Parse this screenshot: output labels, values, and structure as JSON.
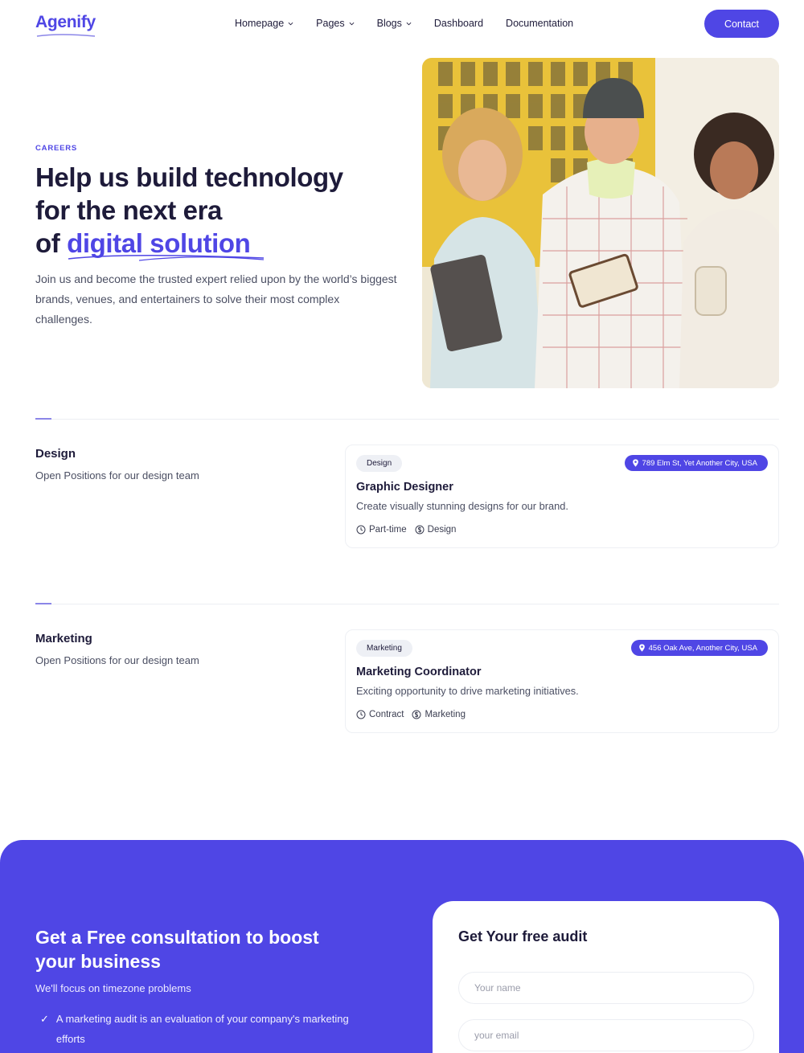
{
  "header": {
    "logo": "Agenify",
    "nav": [
      {
        "label": "Homepage",
        "has_dropdown": true
      },
      {
        "label": "Pages",
        "has_dropdown": true
      },
      {
        "label": "Blogs",
        "has_dropdown": true
      },
      {
        "label": "Dashboard",
        "has_dropdown": false
      },
      {
        "label": "Documentation",
        "has_dropdown": false
      }
    ],
    "contact_label": "Contact"
  },
  "hero": {
    "eyebrow": "CAREERS",
    "title_line1": "Help us build technology",
    "title_line2": "for the next era",
    "title_line3_prefix": "of ",
    "title_accent": "digital solution",
    "description": "Join us and become the trusted expert relied upon by the world’s biggest brands, venues, and entertainers to solve their most complex challenges."
  },
  "sections": [
    {
      "title": "Design",
      "subtitle": "Open Positions for our design team",
      "job": {
        "tag": "Design",
        "location": "789 Elm St, Yet Another City, USA",
        "title": "Graphic Designer",
        "description": "Create visually stunning designs for our brand.",
        "type": "Part-time",
        "category": "Design"
      }
    },
    {
      "title": "Marketing",
      "subtitle": "Open Positions for our design team",
      "job": {
        "tag": "Marketing",
        "location": "456 Oak Ave, Another City, USA",
        "title": "Marketing Coordinator",
        "description": "Exciting opportunity to drive marketing initiatives.",
        "type": "Contract",
        "category": "Marketing"
      }
    }
  ],
  "cta": {
    "title": "Get a Free consultation to boost your business",
    "subtitle": "We'll focus on timezone problems",
    "checklist": [
      "A marketing audit is an evaluation of your company's marketing efforts"
    ]
  },
  "audit_form": {
    "title": "Get Your free audit",
    "name_placeholder": "Your name",
    "email_placeholder": "your email"
  },
  "colors": {
    "accent": "#4f46e5",
    "text_dark": "#1e1b3a",
    "text_muted": "#4b4f63"
  }
}
